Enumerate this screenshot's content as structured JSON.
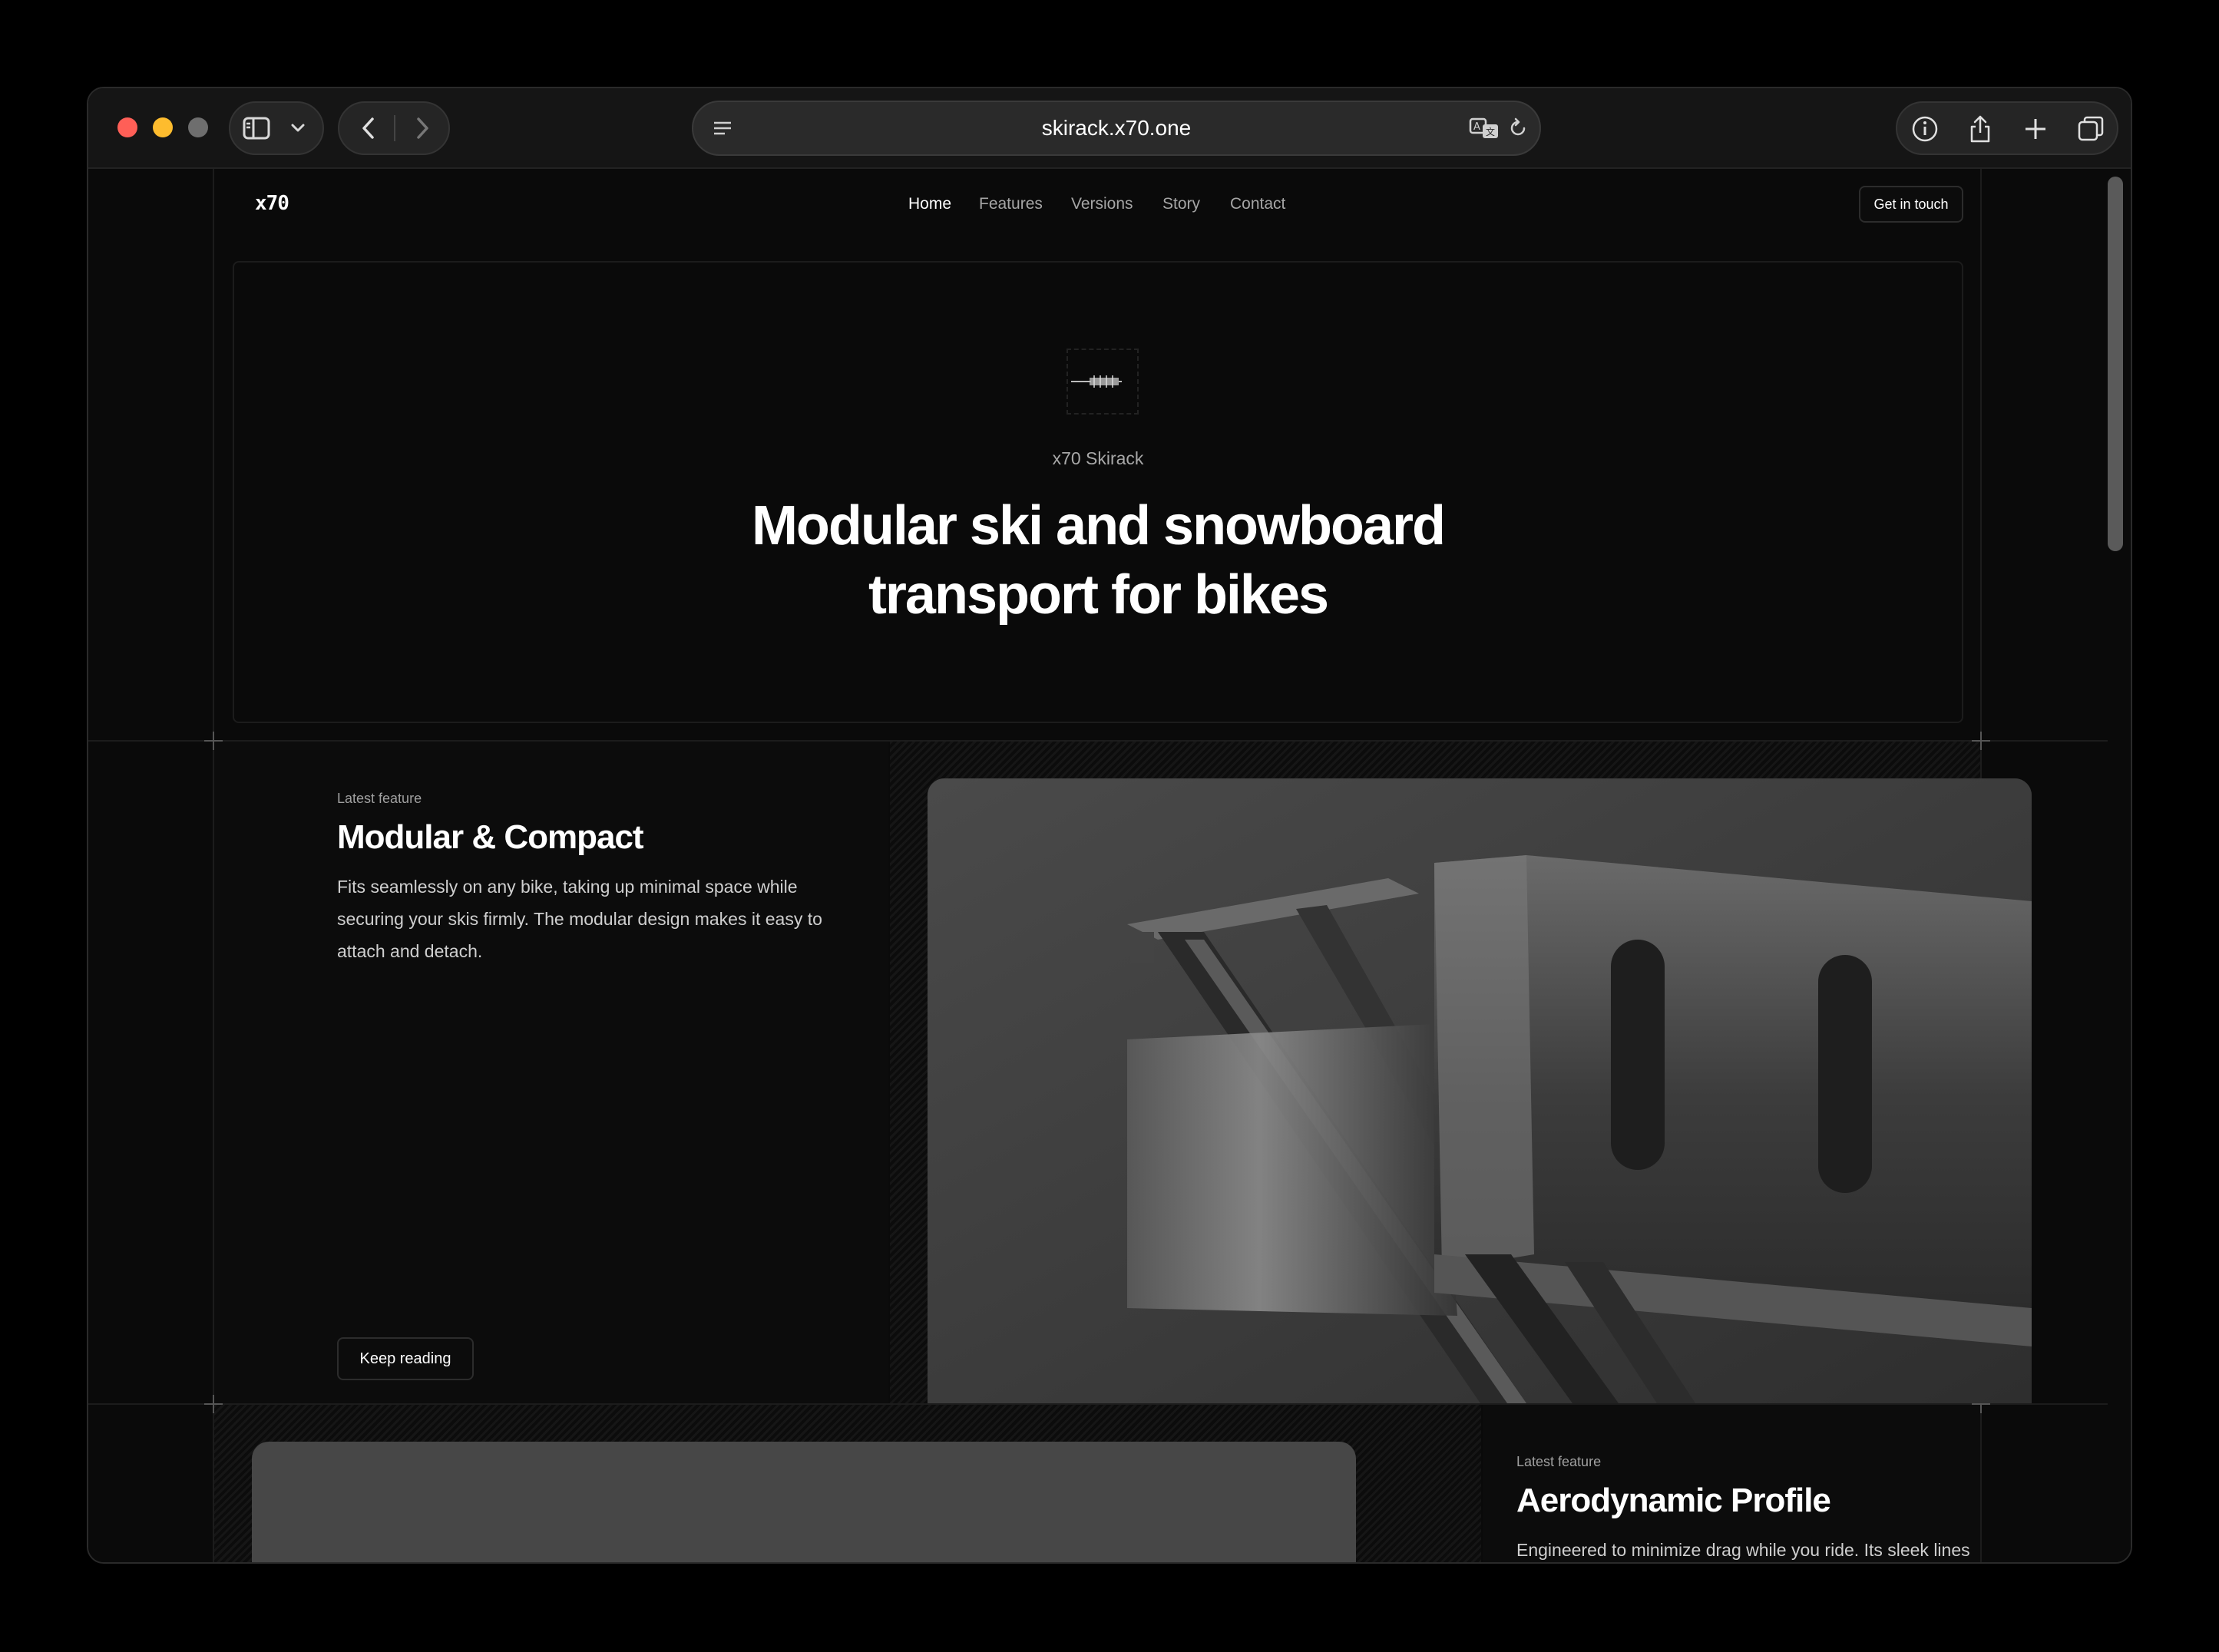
{
  "browser": {
    "url": "skirack.x70.one",
    "colors": {
      "close": "#ff5f57",
      "minimize": "#febc2e",
      "zoom": "#6e6e6e"
    },
    "icons": [
      "sidebar-icon",
      "chevron-down-icon",
      "back-arrow-icon",
      "forward-arrow-icon",
      "reader-icon",
      "translate-icon",
      "reload-icon",
      "info-icon",
      "share-icon",
      "new-tab-icon",
      "tabs-overview-icon"
    ]
  },
  "nav": {
    "logo": "x70",
    "links": [
      "Home",
      "Features",
      "Versions",
      "Story",
      "Contact"
    ],
    "active": "Home",
    "cta": "Get in touch"
  },
  "hero": {
    "eyebrow": "x70 Skirack",
    "title_line1": "Modular ski and snowboard",
    "title_line2": "transport for bikes"
  },
  "features": [
    {
      "eyebrow": "Latest feature",
      "title": "Modular & Compact",
      "body": "Fits seamlessly on any bike, taking up minimal space while securing your skis firmly. The modular design makes it easy to attach and detach.",
      "button": "Keep reading"
    },
    {
      "eyebrow": "Latest feature",
      "title": "Aerodynamic Profile",
      "body": "Engineered to minimize drag while you ride. Its sleek lines"
    }
  ]
}
